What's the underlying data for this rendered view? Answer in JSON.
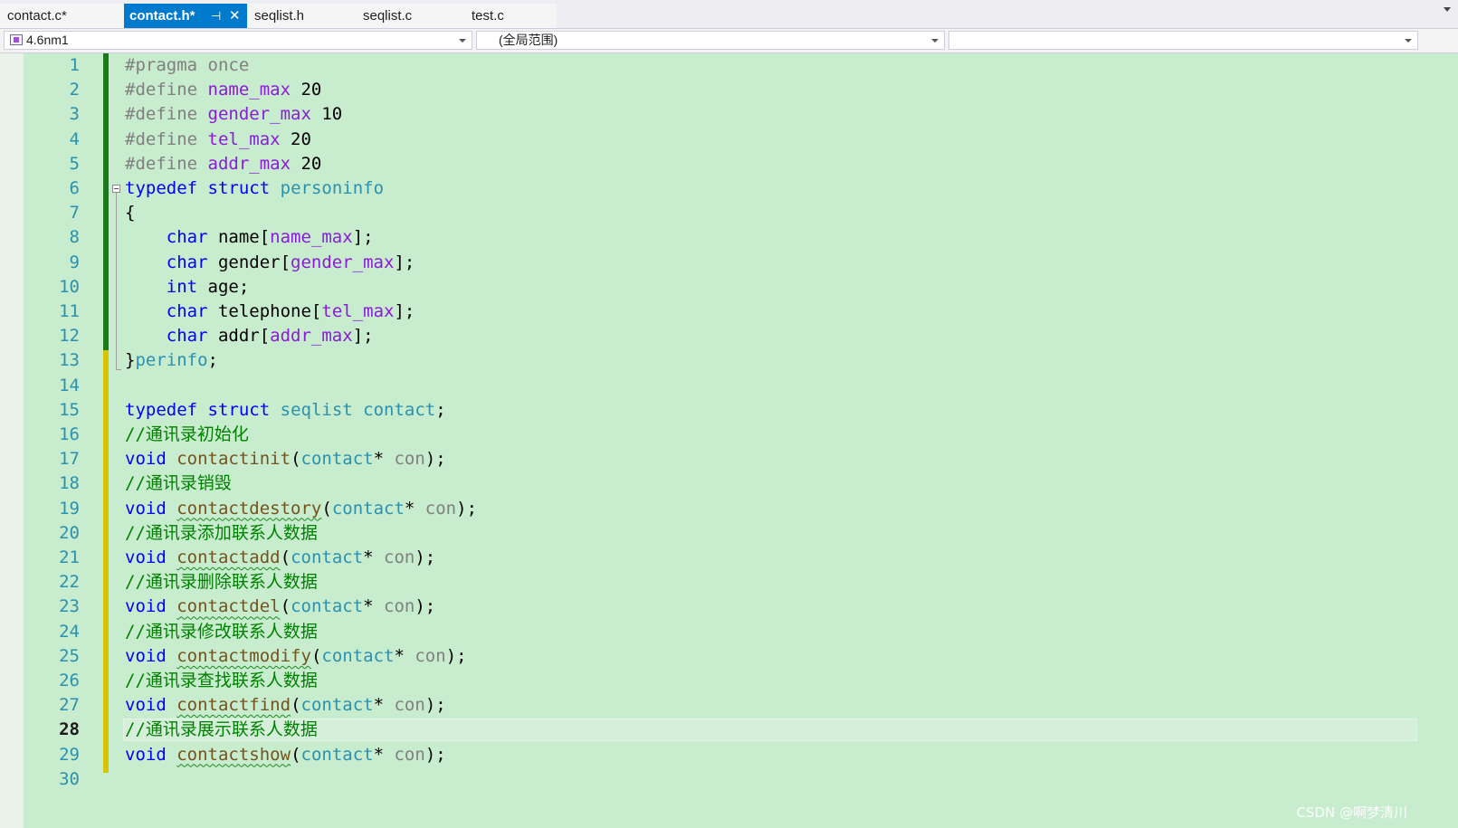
{
  "tabs": [
    {
      "label": "contact.c*",
      "active": false
    },
    {
      "label": "contact.h*",
      "active": true,
      "pin_icon": "pin-icon",
      "close_icon": "close-icon"
    },
    {
      "label": "seqlist.h",
      "active": false
    },
    {
      "label": "seqlist.c",
      "active": false
    },
    {
      "label": "test.c",
      "active": false
    }
  ],
  "navbar": {
    "project": "4.6nm1",
    "scope": "(全局范围)",
    "member": ""
  },
  "editor": {
    "current_line": 28,
    "lines": [
      [
        [
          "pre",
          "#pragma once"
        ]
      ],
      [
        [
          "pre",
          "#define "
        ],
        [
          "mac",
          "name_max"
        ],
        [
          "num",
          " 20"
        ]
      ],
      [
        [
          "pre",
          "#define "
        ],
        [
          "mac",
          "gender_max"
        ],
        [
          "num",
          " 10"
        ]
      ],
      [
        [
          "pre",
          "#define "
        ],
        [
          "mac",
          "tel_max"
        ],
        [
          "num",
          " 20"
        ]
      ],
      [
        [
          "pre",
          "#define "
        ],
        [
          "mac",
          "addr_max"
        ],
        [
          "num",
          " 20"
        ]
      ],
      [
        [
          "kw",
          "typedef"
        ],
        [
          "plain",
          " "
        ],
        [
          "kw",
          "struct"
        ],
        [
          "plain",
          " "
        ],
        [
          "type",
          "personinfo"
        ]
      ],
      [
        [
          "plain",
          "{"
        ]
      ],
      [
        [
          "plain",
          "    "
        ],
        [
          "kw",
          "char"
        ],
        [
          "plain",
          " name["
        ],
        [
          "mac",
          "name_max"
        ],
        [
          "plain",
          "];"
        ]
      ],
      [
        [
          "plain",
          "    "
        ],
        [
          "kw",
          "char"
        ],
        [
          "plain",
          " gender["
        ],
        [
          "mac",
          "gender_max"
        ],
        [
          "plain",
          "];"
        ]
      ],
      [
        [
          "plain",
          "    "
        ],
        [
          "kw",
          "int"
        ],
        [
          "plain",
          " age;"
        ]
      ],
      [
        [
          "plain",
          "    "
        ],
        [
          "kw",
          "char"
        ],
        [
          "plain",
          " telephone["
        ],
        [
          "mac",
          "tel_max"
        ],
        [
          "plain",
          "];"
        ]
      ],
      [
        [
          "plain",
          "    "
        ],
        [
          "kw",
          "char"
        ],
        [
          "plain",
          " addr["
        ],
        [
          "mac",
          "addr_max"
        ],
        [
          "plain",
          "];"
        ]
      ],
      [
        [
          "plain",
          "}"
        ],
        [
          "type",
          "perinfo"
        ],
        [
          "plain",
          ";"
        ]
      ],
      [],
      [
        [
          "kw",
          "typedef"
        ],
        [
          "plain",
          " "
        ],
        [
          "kw",
          "struct"
        ],
        [
          "plain",
          " "
        ],
        [
          "type",
          "seqlist"
        ],
        [
          "plain",
          " "
        ],
        [
          "type",
          "contact"
        ],
        [
          "plain",
          ";"
        ]
      ],
      [
        [
          "cmt",
          "//通讯录初始化"
        ]
      ],
      [
        [
          "kw",
          "void"
        ],
        [
          "plain",
          " "
        ],
        [
          "fn",
          "contactinit"
        ],
        [
          "plain",
          "("
        ],
        [
          "type",
          "contact"
        ],
        [
          "plain",
          "* "
        ],
        [
          "param",
          "con"
        ],
        [
          "plain",
          ");"
        ]
      ],
      [
        [
          "cmt",
          "//通讯录销毁"
        ]
      ],
      [
        [
          "kw",
          "void"
        ],
        [
          "plain",
          " "
        ],
        [
          "fnsq",
          "contactdestory"
        ],
        [
          "plain",
          "("
        ],
        [
          "type",
          "contact"
        ],
        [
          "plain",
          "* "
        ],
        [
          "param",
          "con"
        ],
        [
          "plain",
          ");"
        ]
      ],
      [
        [
          "cmt",
          "//通讯录添加联系人数据"
        ]
      ],
      [
        [
          "kw",
          "void"
        ],
        [
          "plain",
          " "
        ],
        [
          "fnsq",
          "contactadd"
        ],
        [
          "plain",
          "("
        ],
        [
          "type",
          "contact"
        ],
        [
          "plain",
          "* "
        ],
        [
          "param",
          "con"
        ],
        [
          "plain",
          ");"
        ]
      ],
      [
        [
          "cmt",
          "//通讯录删除联系人数据"
        ]
      ],
      [
        [
          "kw",
          "void"
        ],
        [
          "plain",
          " "
        ],
        [
          "fnsq",
          "contactdel"
        ],
        [
          "plain",
          "("
        ],
        [
          "type",
          "contact"
        ],
        [
          "plain",
          "* "
        ],
        [
          "param",
          "con"
        ],
        [
          "plain",
          ");"
        ]
      ],
      [
        [
          "cmt",
          "//通讯录修改联系人数据"
        ]
      ],
      [
        [
          "kw",
          "void"
        ],
        [
          "plain",
          " "
        ],
        [
          "fnsq",
          "contactmodify"
        ],
        [
          "plain",
          "("
        ],
        [
          "type",
          "contact"
        ],
        [
          "plain",
          "* "
        ],
        [
          "param",
          "con"
        ],
        [
          "plain",
          ");"
        ]
      ],
      [
        [
          "cmt",
          "//通讯录查找联系人数据"
        ]
      ],
      [
        [
          "kw",
          "void"
        ],
        [
          "plain",
          " "
        ],
        [
          "fnsq",
          "contactfind"
        ],
        [
          "plain",
          "("
        ],
        [
          "type",
          "contact"
        ],
        [
          "plain",
          "* "
        ],
        [
          "param",
          "con"
        ],
        [
          "plain",
          ");"
        ]
      ],
      [
        [
          "cmt",
          "//通讯录展示联系人数据"
        ]
      ],
      [
        [
          "kw",
          "void"
        ],
        [
          "plain",
          " "
        ],
        [
          "fnsq",
          "contactshow"
        ],
        [
          "plain",
          "("
        ],
        [
          "type",
          "contact"
        ],
        [
          "plain",
          "* "
        ],
        [
          "param",
          "con"
        ],
        [
          "plain",
          ");"
        ]
      ],
      []
    ]
  },
  "colors": {
    "editor_bg": "#c7ecce",
    "active_tab": "#007acc",
    "keyword": "#0000ff",
    "macro": "#8a1bd8",
    "type": "#2b91af",
    "comment": "#008000",
    "function": "#74531f"
  },
  "watermark": "CSDN @啊梦清川"
}
